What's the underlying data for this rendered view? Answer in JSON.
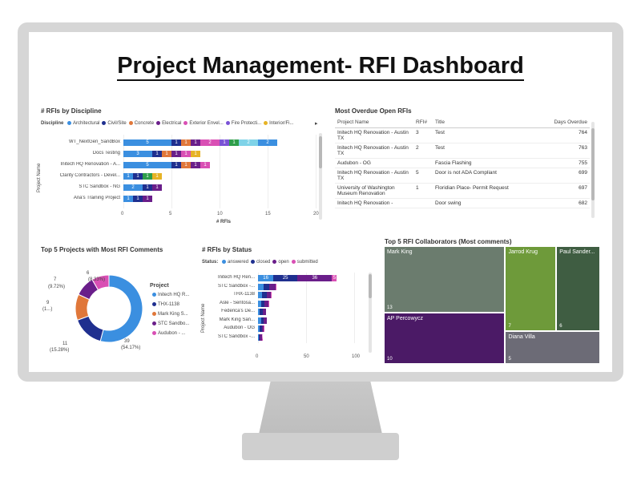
{
  "dashboard_title": "Project Management- RFI Dashboard",
  "discipline_chart": {
    "title": "# RFIs by Discipline",
    "legend_label": "Discipline",
    "legend": [
      {
        "name": "Architectural",
        "color": "#3B8FE0"
      },
      {
        "name": "Civil/Site",
        "color": "#1F2F8F"
      },
      {
        "name": "Concrete",
        "color": "#E0773A"
      },
      {
        "name": "Electrical",
        "color": "#6A1E8A"
      },
      {
        "name": "Exterior Envel...",
        "color": "#D94FB4"
      },
      {
        "name": "Fire Protecti...",
        "color": "#7A52D6"
      },
      {
        "name": "Interior/Fi...",
        "color": "#E6B325"
      }
    ],
    "y_axis_title": "Project Name",
    "x_axis_title": "# RFIs",
    "x_ticks": [
      "0",
      "5",
      "10",
      "15",
      "20"
    ]
  },
  "overdue_table": {
    "title": "Most Overdue Open RFIs",
    "columns": [
      "Project Name",
      "RFI#",
      "Title",
      "Days Overdue"
    ],
    "rows": [
      {
        "project": "Initech HQ Renovation - Austin TX",
        "rfi": "3",
        "title": "Test",
        "days": "764"
      },
      {
        "project": "Initech HQ Renovation - Austin TX",
        "rfi": "2",
        "title": "Test",
        "days": "763"
      },
      {
        "project": "Audubon - OG",
        "rfi": "",
        "title": "Fascia Flashing",
        "days": "755"
      },
      {
        "project": "Initech HQ Renovation - Austin TX",
        "rfi": "5",
        "title": "Door is not ADA Compliant",
        "days": "699"
      },
      {
        "project": "University of Washington Museum Renovation",
        "rfi": "1",
        "title": "Floridian Place- Permit Request",
        "days": "697"
      },
      {
        "project": "Initech HQ Renovation -",
        "rfi": "",
        "title": "Door swing",
        "days": "682"
      }
    ]
  },
  "donut_chart": {
    "title": "Top 5 Projects with Most RFI Comments",
    "legend_title": "Project",
    "legend": [
      {
        "name": "Initech HQ R...",
        "color": "#3B8FE0"
      },
      {
        "name": "THX-1138",
        "color": "#1F2F8F"
      },
      {
        "name": "Mark King S...",
        "color": "#E0773A"
      },
      {
        "name": "STC Sandbo...",
        "color": "#6A1E8A"
      },
      {
        "name": "Audubon - ...",
        "color": "#D94FB4"
      }
    ],
    "labels": {
      "l6": "6",
      "l6p": "(8.33%)",
      "l7": "7",
      "l7p": "(9.72%)",
      "l9": "9",
      "l9p": "(1...)",
      "l11": "11",
      "l11p": "(15.28%)",
      "l39": "39",
      "l39p": "(54.17%)"
    }
  },
  "status_chart": {
    "title": "# RFIs by Status",
    "legend_label": "Status:",
    "legend": [
      {
        "name": "answered",
        "color": "#3B8FE0"
      },
      {
        "name": "closed",
        "color": "#1F2F8F"
      },
      {
        "name": "open",
        "color": "#6A1E8A"
      },
      {
        "name": "submitted",
        "color": "#D94FB4"
      }
    ],
    "y_axis_title": "Project Name",
    "x_ticks": [
      "0",
      "50",
      "100"
    ],
    "categories": [
      "Initech HQ Ren...",
      "STC Sandbox -...",
      "THX-1138",
      "Asle - Sentosa...",
      "Federica's De...",
      "Mark King San...",
      "Audubon - OG",
      "STC Sandbox -..."
    ]
  },
  "treemap": {
    "title": "Top 5 RFI Collaborators (Most comments)",
    "tiles": [
      {
        "name": "Mark King",
        "value": "13"
      },
      {
        "name": "AP Percowycz",
        "value": "10"
      },
      {
        "name": "Jarrod Krug",
        "value": "7"
      },
      {
        "name": "Paul Sander...",
        "value": "6"
      },
      {
        "name": "Diana Villa",
        "value": "5"
      }
    ]
  },
  "chart_data": [
    {
      "type": "bar",
      "title": "# RFIs by Discipline",
      "xlabel": "# RFIs",
      "ylabel": "Project Name",
      "xlim": [
        0,
        20
      ],
      "categories": [
        "WT_NextGen_SandBox",
        "Docs Testing",
        "Initech HQ Renovation - A...",
        "Clarity Contractors - Devel...",
        "STC Sandbox - NG",
        "Ana's Training Project"
      ],
      "stacked": true,
      "segments": [
        [
          [
            5,
            "#3B8FE0",
            "5"
          ],
          [
            1,
            "#1F2F8F",
            "1"
          ],
          [
            1,
            "#E0773A",
            "1"
          ],
          [
            1,
            "#6A1E8A",
            "1"
          ],
          [
            2,
            "#D94FB4",
            "2"
          ],
          [
            1,
            "#7A52D6",
            "1"
          ],
          [
            1,
            "#2E9E4A",
            "1"
          ],
          [
            2,
            "#7FD3E8",
            "2"
          ],
          [
            2,
            "#3B8FE0",
            "2"
          ]
        ],
        [
          [
            3,
            "#3B8FE0",
            "3"
          ],
          [
            1,
            "#1F2F8F",
            "1"
          ],
          [
            1,
            "#E0773A",
            "1"
          ],
          [
            1,
            "#6A1E8A",
            "1"
          ],
          [
            1,
            "#D94FB4",
            "1"
          ],
          [
            1,
            "#E6B325",
            "1"
          ]
        ],
        [
          [
            5,
            "#3B8FE0",
            "5"
          ],
          [
            1,
            "#1F2F8F",
            "1"
          ],
          [
            1,
            "#E0773A",
            "1"
          ],
          [
            1,
            "#6A1E8A",
            "1"
          ],
          [
            1,
            "#D94FB4",
            "1"
          ]
        ],
        [
          [
            1,
            "#3B8FE0",
            "1"
          ],
          [
            1,
            "#1F2F8F",
            "1"
          ],
          [
            1,
            "#2E9E4A",
            "1"
          ],
          [
            1,
            "#E6B325",
            "1"
          ]
        ],
        [
          [
            2,
            "#3B8FE0",
            "2"
          ],
          [
            1,
            "#1F2F8F",
            "1"
          ],
          [
            1,
            "#6A1E8A",
            "1"
          ]
        ],
        [
          [
            1,
            "#3B8FE0",
            "1"
          ],
          [
            1,
            "#1F2F8F",
            "1"
          ],
          [
            1,
            "#6A1E8A",
            "1"
          ]
        ]
      ]
    },
    {
      "type": "pie",
      "title": "Top 5 Projects with Most RFI Comments",
      "categories": [
        "Initech HQ R...",
        "THX-1138",
        "Mark King S...",
        "STC Sandbo...",
        "Audubon - ..."
      ],
      "values": [
        39,
        11,
        9,
        7,
        6
      ]
    },
    {
      "type": "bar",
      "title": "# RFIs by Status",
      "stacked": true,
      "xlim": [
        0,
        100
      ],
      "categories": [
        "Initech HQ Ren...",
        "STC Sandbox -...",
        "THX-1138",
        "Asle - Sentosa...",
        "Federica's De...",
        "Mark King San...",
        "Audubon - OG",
        "STC Sandbox -..."
      ],
      "series": [
        {
          "name": "answered",
          "values": [
            16,
            6,
            4,
            3,
            2,
            3,
            2,
            1
          ]
        },
        {
          "name": "closed",
          "values": [
            25,
            6,
            5,
            4,
            3,
            3,
            2,
            1
          ]
        },
        {
          "name": "open",
          "values": [
            36,
            6,
            4,
            4,
            3,
            3,
            2,
            2
          ]
        },
        {
          "name": "submitted",
          "values": [
            5,
            1,
            1,
            1,
            0,
            0,
            1,
            1
          ]
        }
      ],
      "data_labels": [
        [
          "16",
          "25",
          "36",
          "5"
        ],
        [],
        [],
        [],
        [],
        [],
        [],
        [
          "5"
        ]
      ]
    },
    {
      "type": "treemap",
      "title": "Top 5 RFI Collaborators (Most comments)",
      "categories": [
        "Mark King",
        "AP Percowycz",
        "Jarrod Krug",
        "Paul Sander...",
        "Diana Villa"
      ],
      "values": [
        13,
        10,
        7,
        6,
        5
      ]
    }
  ]
}
